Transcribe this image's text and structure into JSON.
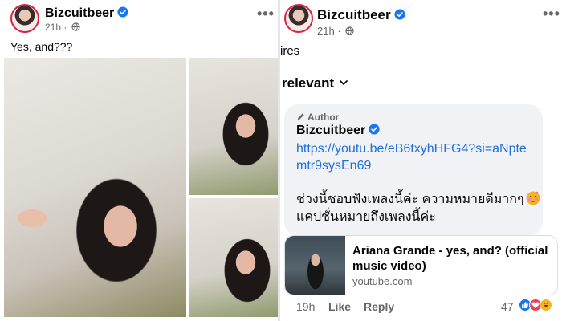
{
  "left_post": {
    "author": "Bizcuitbeer",
    "time": "21h",
    "separator": "·",
    "caption": "Yes, and???",
    "more": "•••",
    "photos": [
      "photo-main",
      "photo-top",
      "photo-bottom"
    ]
  },
  "right_post": {
    "author": "Bizcuitbeer",
    "time": "21h",
    "separator": "·",
    "more": "•••",
    "clipped_text": "ires",
    "sort_label": "relevant",
    "comment": {
      "badge": "Author",
      "author": "Bizcuitbeer",
      "link": "https://youtu.be/eB6txyhHFG4?si=aNptemtr9sysEn69",
      "text_line1": "ช่วงนี้ชอบฟังเพลงนี้ค่ะ ความหมายดีมากๆ",
      "text_line2": "แคปชั่นหมายถึงเพลงนี้ค่ะ"
    },
    "preview": {
      "title": "Ariana Grande - yes, and? (official music video)",
      "domain": "youtube.com"
    },
    "actions": {
      "time": "19h",
      "like": "Like",
      "reply": "Reply",
      "reaction_count": "47"
    }
  },
  "colors": {
    "verified": "#1877f2",
    "link": "#216fdb",
    "secondary_text": "#65676b",
    "bubble": "#f0f2f5"
  },
  "icons": [
    "verified-icon",
    "globe-icon",
    "more-icon",
    "chevron-down-icon",
    "pen-icon",
    "blush-icon",
    "like-reaction-icon",
    "love-reaction-icon",
    "haha-reaction-icon"
  ]
}
